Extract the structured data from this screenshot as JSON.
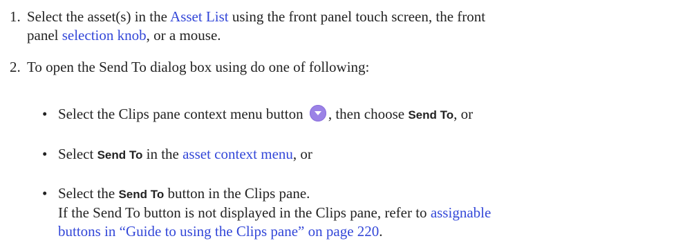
{
  "step1": {
    "number": "1.",
    "text_a": "Select the asset(s) in the ",
    "link_asset_list": "Asset List",
    "text_b": " using the front panel touch screen, the front",
    "text_c": "panel ",
    "link_selection_knob": "selection knob",
    "text_d": ", or a mouse."
  },
  "step2": {
    "number": "2.",
    "text": "To open the Send To dialog box using do one of following:"
  },
  "bullets": {
    "dot": "•",
    "item1": {
      "text_a": "Select the Clips pane context menu button ",
      "icon": "context-menu-chevron-icon",
      "text_b": ", then choose ",
      "bold": "Send To",
      "text_c": ", or"
    },
    "item2": {
      "text_a": "Select ",
      "bold": "Send To",
      "text_b": " in the ",
      "link": "asset context menu",
      "text_c": ", or"
    },
    "item3": {
      "text_a": "Select the ",
      "bold": "Send To",
      "text_b": " button in the Clips pane.",
      "line2": "If the Send To button is not displayed in the Clips pane, refer to ",
      "link_a": "assignable",
      "link_b": "buttons in “Guide to using the Clips pane” on page 220",
      "text_end": "."
    }
  },
  "colors": {
    "link": "#3347d8",
    "icon": "#9b82e6"
  }
}
